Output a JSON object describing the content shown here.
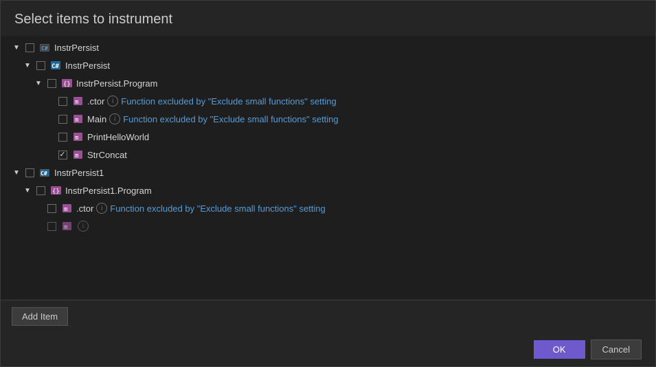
{
  "dialog": {
    "title": "Select items to instrument",
    "ok_label": "OK",
    "cancel_label": "Cancel",
    "add_item_label": "Add Item"
  },
  "tree": {
    "items": [
      {
        "id": "instrpersist-root",
        "level": 0,
        "chevron": "down",
        "checkbox": "partial",
        "icon": "assembly",
        "label": "InstrPersist",
        "info": false,
        "excluded": false
      },
      {
        "id": "instrpersist-assembly",
        "level": 1,
        "chevron": "down",
        "checkbox": "partial",
        "icon": "csharp",
        "label": "InstrPersist",
        "info": false,
        "excluded": false
      },
      {
        "id": "instrpersist-program",
        "level": 2,
        "chevron": "down",
        "checkbox": "partial",
        "icon": "namespace",
        "label": "InstrPersist.Program",
        "info": false,
        "excluded": false
      },
      {
        "id": "ctor1",
        "level": 3,
        "chevron": "none",
        "checkbox": "unchecked",
        "icon": "method",
        "label": ".ctor",
        "info": true,
        "excluded": true,
        "excluded_text": "Function excluded by \"Exclude small functions\" setting"
      },
      {
        "id": "main",
        "level": 3,
        "chevron": "none",
        "checkbox": "unchecked",
        "icon": "method",
        "label": "Main",
        "info": true,
        "excluded": true,
        "excluded_text": "Function excluded by \"Exclude small functions\" setting"
      },
      {
        "id": "printhelloworld",
        "level": 3,
        "chevron": "none",
        "checkbox": "unchecked",
        "icon": "method",
        "label": "PrintHelloWorld",
        "info": false,
        "excluded": false
      },
      {
        "id": "strconcat",
        "level": 3,
        "chevron": "none",
        "checkbox": "checked",
        "icon": "method",
        "label": "StrConcat",
        "info": false,
        "excluded": false
      },
      {
        "id": "instrpersist1-root",
        "level": 0,
        "chevron": "down",
        "checkbox": "partial",
        "icon": "assembly",
        "label": "InstrPersist1",
        "info": false,
        "excluded": false
      },
      {
        "id": "instrpersist1-program",
        "level": 1,
        "chevron": "down",
        "checkbox": "partial",
        "icon": "namespace",
        "label": "InstrPersist1.Program",
        "info": false,
        "excluded": false
      },
      {
        "id": "ctor2",
        "level": 2,
        "chevron": "none",
        "checkbox": "unchecked",
        "icon": "method",
        "label": ".ctor",
        "info": true,
        "excluded": true,
        "excluded_text": "Function excluded by \"Exclude small functions\" setting"
      },
      {
        "id": "main2",
        "level": 2,
        "chevron": "none",
        "checkbox": "unchecked",
        "icon": "method",
        "label": "",
        "info": true,
        "excluded": true,
        "excluded_text": ""
      }
    ]
  }
}
